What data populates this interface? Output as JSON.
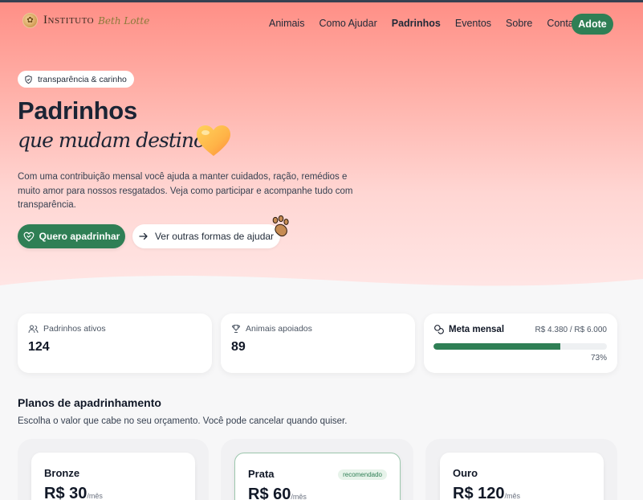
{
  "brand": {
    "name_main": "Instituto",
    "name_script": "Beth Lotte"
  },
  "nav": {
    "items": [
      {
        "label": "Animais",
        "active": false
      },
      {
        "label": "Como Ajudar",
        "active": false
      },
      {
        "label": "Padrinhos",
        "active": true
      },
      {
        "label": "Eventos",
        "active": false
      },
      {
        "label": "Sobre",
        "active": false
      },
      {
        "label": "Contato",
        "active": false
      }
    ],
    "cta_label": "Adote"
  },
  "hero": {
    "pill_label": "transparência & carinho",
    "title": "Padrinhos",
    "subtitle": "que mudam destinos",
    "lead": "Com uma contribuição mensal você ajuda a manter cuidados, ração, remédios e muito amor para nossos resgatados. Veja como participar e acompanhe tudo com transparência.",
    "primary_cta": "Quero apadrinhar",
    "secondary_cta": "Ver outras formas de ajudar"
  },
  "stats": {
    "padrinhos": {
      "label": "Padrinhos ativos",
      "value": "124"
    },
    "animais": {
      "label": "Animais apoiados",
      "value": "89"
    },
    "meta": {
      "label": "Meta mensal",
      "amount": "R$ 4.380 / R$ 6.000",
      "percent_label": "73%",
      "progress": 0.73
    }
  },
  "plans_section": {
    "title": "Planos de apadrinhamento",
    "subtitle": "Escolha o valor que cabe no seu orçamento. Você pode cancelar quando quiser.",
    "plans": [
      {
        "name": "Bronze",
        "price": "R$ 30",
        "period": "/mês"
      },
      {
        "name": "Prata",
        "price": "R$ 60",
        "period": "/mês",
        "badge": "recomendado"
      },
      {
        "name": "Ouro",
        "price": "R$ 120",
        "period": "/mês"
      }
    ]
  },
  "colors": {
    "accent": "#2f7f55",
    "hero_top": "#ff8f86",
    "hero_bottom": "#ffe7e6"
  }
}
